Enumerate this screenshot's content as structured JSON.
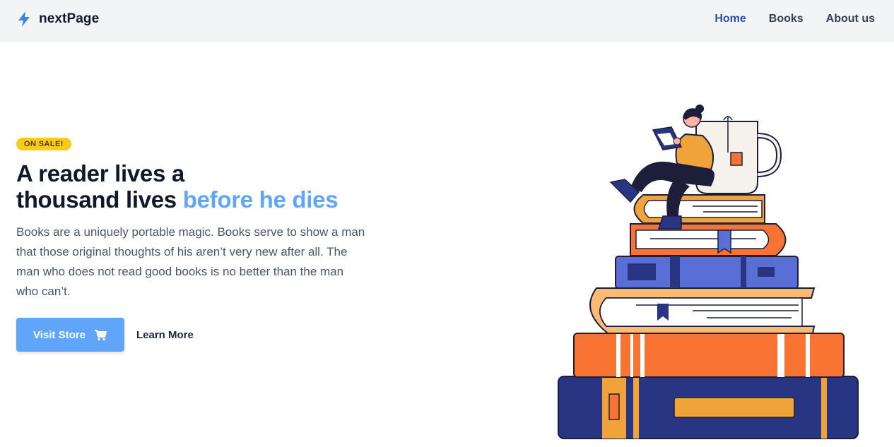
{
  "navbar": {
    "brand": "nextPage",
    "brand_icon": "lightning-bolt-icon",
    "links": [
      {
        "label": "Home",
        "active": true
      },
      {
        "label": "Books",
        "active": false
      },
      {
        "label": "About us",
        "active": false
      }
    ]
  },
  "hero": {
    "badge": "ON SALE!",
    "headline_line1": "A reader lives a",
    "headline_line2": "thousand lives",
    "headline_accent": "before he dies",
    "description": "Books are a uniquely portable magic. Books serve to show a man that those original thoughts of his aren’t very new after all. The man who does not read good books is no better than the man who can’t.",
    "primary_button": "Visit Store",
    "primary_button_icon": "shopping-cart-icon",
    "secondary_button": "Learn More"
  },
  "illustration": {
    "subject": "woman-reading-on-book-stack-illustration"
  },
  "colors": {
    "accent": "#60a5fa",
    "nav_active": "#2d4fb3",
    "badge": "#facc15",
    "navbar_bg": "#f3f4f6"
  }
}
